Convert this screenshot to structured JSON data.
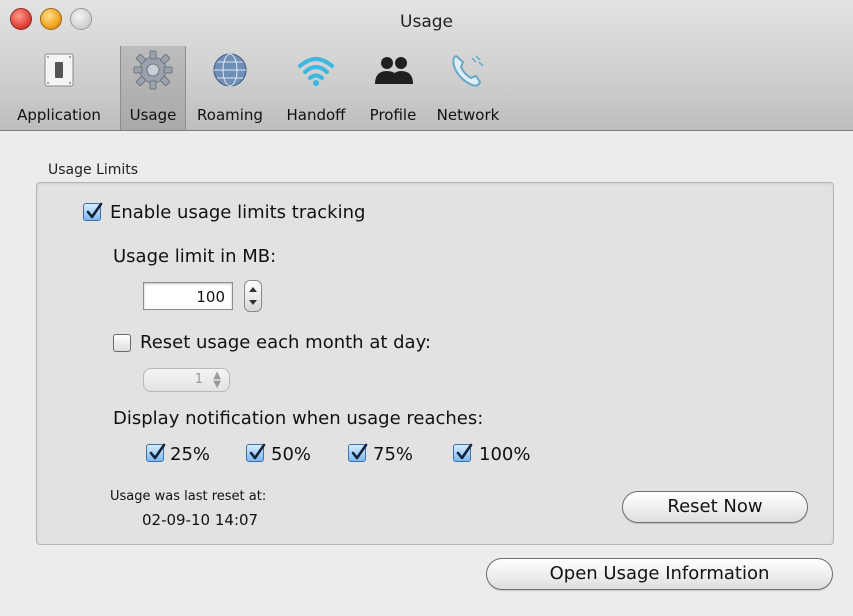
{
  "window": {
    "title": "Usage",
    "controls": [
      "close",
      "minimize",
      "zoom"
    ]
  },
  "toolbar": {
    "selected": "Usage",
    "items": [
      {
        "label": "Application",
        "icon": "switch-icon"
      },
      {
        "label": "Usage",
        "icon": "gear-icon"
      },
      {
        "label": "Roaming",
        "icon": "globe-icon"
      },
      {
        "label": "Handoff",
        "icon": "wifi-icon"
      },
      {
        "label": "Profile",
        "icon": "people-icon"
      },
      {
        "label": "Network",
        "icon": "phone-icon"
      }
    ]
  },
  "usage_limits": {
    "group_label": "Usage Limits",
    "enable_tracking": {
      "label": "Enable usage limits tracking",
      "checked": true
    },
    "limit_label": "Usage limit in MB:",
    "limit_value": "100",
    "reset_monthly": {
      "label": "Reset usage each month at day:",
      "checked": false
    },
    "reset_day": "1",
    "notify_label": "Display notification when usage reaches:",
    "thresholds": [
      {
        "label": "25%",
        "checked": true
      },
      {
        "label": "50%",
        "checked": true
      },
      {
        "label": "75%",
        "checked": true
      },
      {
        "label": "100%",
        "checked": true
      }
    ],
    "last_reset_label": "Usage was last reset at:",
    "last_reset_value": "02-09-10 14:07",
    "reset_now_label": "Reset Now"
  },
  "open_usage_label": "Open Usage Information",
  "colors": {
    "accent": "#3d6fa8",
    "window_bg": "#ececec",
    "group_bg": "#e2e2e2"
  }
}
